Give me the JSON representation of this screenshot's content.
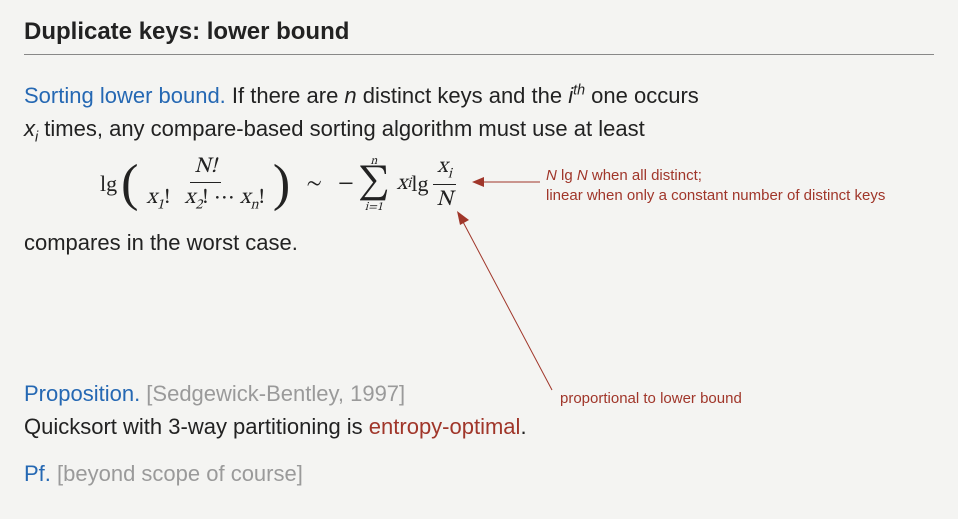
{
  "title": "Duplicate keys:  lower bound",
  "intro": {
    "keyword": "Sorting lower bound.",
    "line1a": "  If there are ",
    "n": "n",
    "line1b": " distinct keys and the ",
    "i": "i",
    "th": "th",
    "line1c": " one occurs",
    "line2a": " times, any compare-based sorting algorithm must use at least",
    "xi_var": "x",
    "xi_sub": "i"
  },
  "formula": {
    "lg": "lg",
    "num": "N!",
    "den_x1": "x",
    "den_s1": "1",
    "den_excl1": "!",
    "den_x2": "x",
    "den_s2": "2",
    "den_excl2": "!",
    "den_dots": " ⋯ ",
    "den_xn": "x",
    "den_sn": "n",
    "den_excln": "!",
    "sim": "∼",
    "minus": "−",
    "sum_top": "n",
    "sum_bot": "i=1",
    "term_x": "x",
    "term_i": "i",
    "term_lg": " lg ",
    "frac2_num_x": "x",
    "frac2_num_i": "i",
    "frac2_den": "N"
  },
  "below": "compares in the worst case.",
  "annot1_l1a": "N",
  "annot1_l1b": " lg ",
  "annot1_l1c": "N",
  "annot1_l1d": " when all distinct;",
  "annot1_l2": "linear when only a constant number of distinct keys",
  "annot2": "proportional to lower bound",
  "prop": {
    "keyword": "Proposition.",
    "cite": "  [Sedgewick-Bentley, 1997]",
    "line2a": "Quicksort with 3-way partitioning is ",
    "entropy": "entropy-optimal",
    "line2b": "."
  },
  "pf": {
    "keyword": "Pf.",
    "note": "  [beyond scope of course]"
  }
}
